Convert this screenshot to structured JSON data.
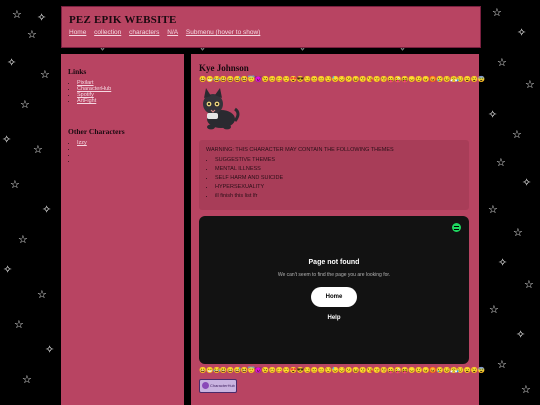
{
  "site_title": "PEZ EPIK WEBSITE",
  "nav": [
    "Home",
    "collection",
    "characters",
    "N/A",
    "Submenu (hover to show)"
  ],
  "sidebar": {
    "links_heading": "Links",
    "links": [
      "Pixilart",
      "CharacterHub",
      "Spotify",
      "ArtFight"
    ],
    "other_heading": "Other Characters",
    "other_items": [
      "Izzy",
      "",
      "",
      ""
    ]
  },
  "character": {
    "name": "Kye Johnson",
    "emoji_row": "😀😁😂😃😄😅😆😇😈😉😊😋😌😍😎😏😐😑😒😓😔😕😖😗😘😙😚😛😜😝😞😟😠😡😢😣😤😥😦😧😨"
  },
  "warning": {
    "title": "WARNING: THIS CHARACTER MAY CONTAIN THE FOLLOWING THEMES",
    "items": [
      "SUGGESTIVE THEMES",
      "MENTAL ILLNESS",
      "SELF HARM AND SUICIDE",
      "HYPERSEXUALITY",
      "ill finish this list lfr"
    ]
  },
  "spotify_embed": {
    "title": "Page not found",
    "description": "We can't seem to find the page you are looking for.",
    "home_button": "Home",
    "help_link": "Help"
  },
  "badge": {
    "label": "CharacterHub"
  },
  "colors": {
    "panel": "#b84462",
    "background": "#000000",
    "spotify_green": "#1ed760"
  }
}
